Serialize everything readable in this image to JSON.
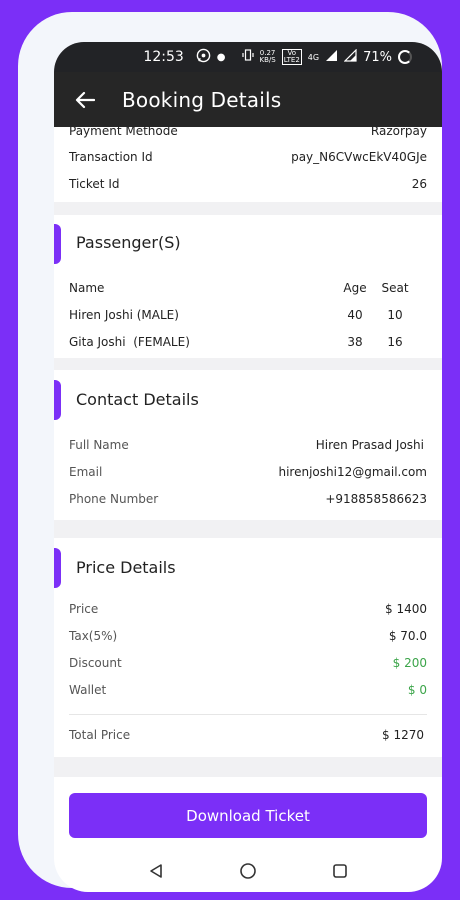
{
  "status_bar": {
    "time": "12:53",
    "speed_top": "0.27",
    "speed_bottom": "KB/S",
    "volte_top": "Vo",
    "volte_bottom": "LTE2",
    "network": "4G",
    "battery": "71%"
  },
  "app_bar": {
    "title": "Booking Details"
  },
  "payment": {
    "method_label": "Payment Methode",
    "method_value": "Razorpay",
    "transaction_label": "Transaction Id",
    "transaction_value": "pay_N6CVwcEkV40GJe",
    "ticket_label": "Ticket Id",
    "ticket_value": "26"
  },
  "passengers": {
    "title": "Passenger(S)",
    "headers": {
      "name": "Name",
      "age": "Age",
      "seat": "Seat"
    },
    "rows": [
      {
        "name": "Hiren Joshi (MALE)",
        "age": "40",
        "seat": "10"
      },
      {
        "name": "Gita Joshi  (FEMALE)",
        "age": "38",
        "seat": "16"
      }
    ]
  },
  "contact": {
    "title": "Contact Details",
    "full_name_label": "Full Name",
    "full_name_value": "Hiren Prasad Joshi",
    "email_label": "Email",
    "email_value": "hirenjoshi12@gmail.com",
    "phone_label": "Phone Number",
    "phone_value": "+918858586623"
  },
  "price": {
    "title": "Price Details",
    "price_label": "Price",
    "price_value": "$ 1400",
    "tax_label": "Tax(5%)",
    "tax_value": "$ 70.0",
    "discount_label": "Discount",
    "discount_value": "$ 200",
    "wallet_label": "Wallet",
    "wallet_value": "$ 0",
    "total_label": "Total Price",
    "total_value": "$ 1270"
  },
  "actions": {
    "download_label": "Download Ticket"
  },
  "colors": {
    "accent": "#7b2ff7",
    "green": "#3ca54a",
    "app_bar": "#262626"
  }
}
